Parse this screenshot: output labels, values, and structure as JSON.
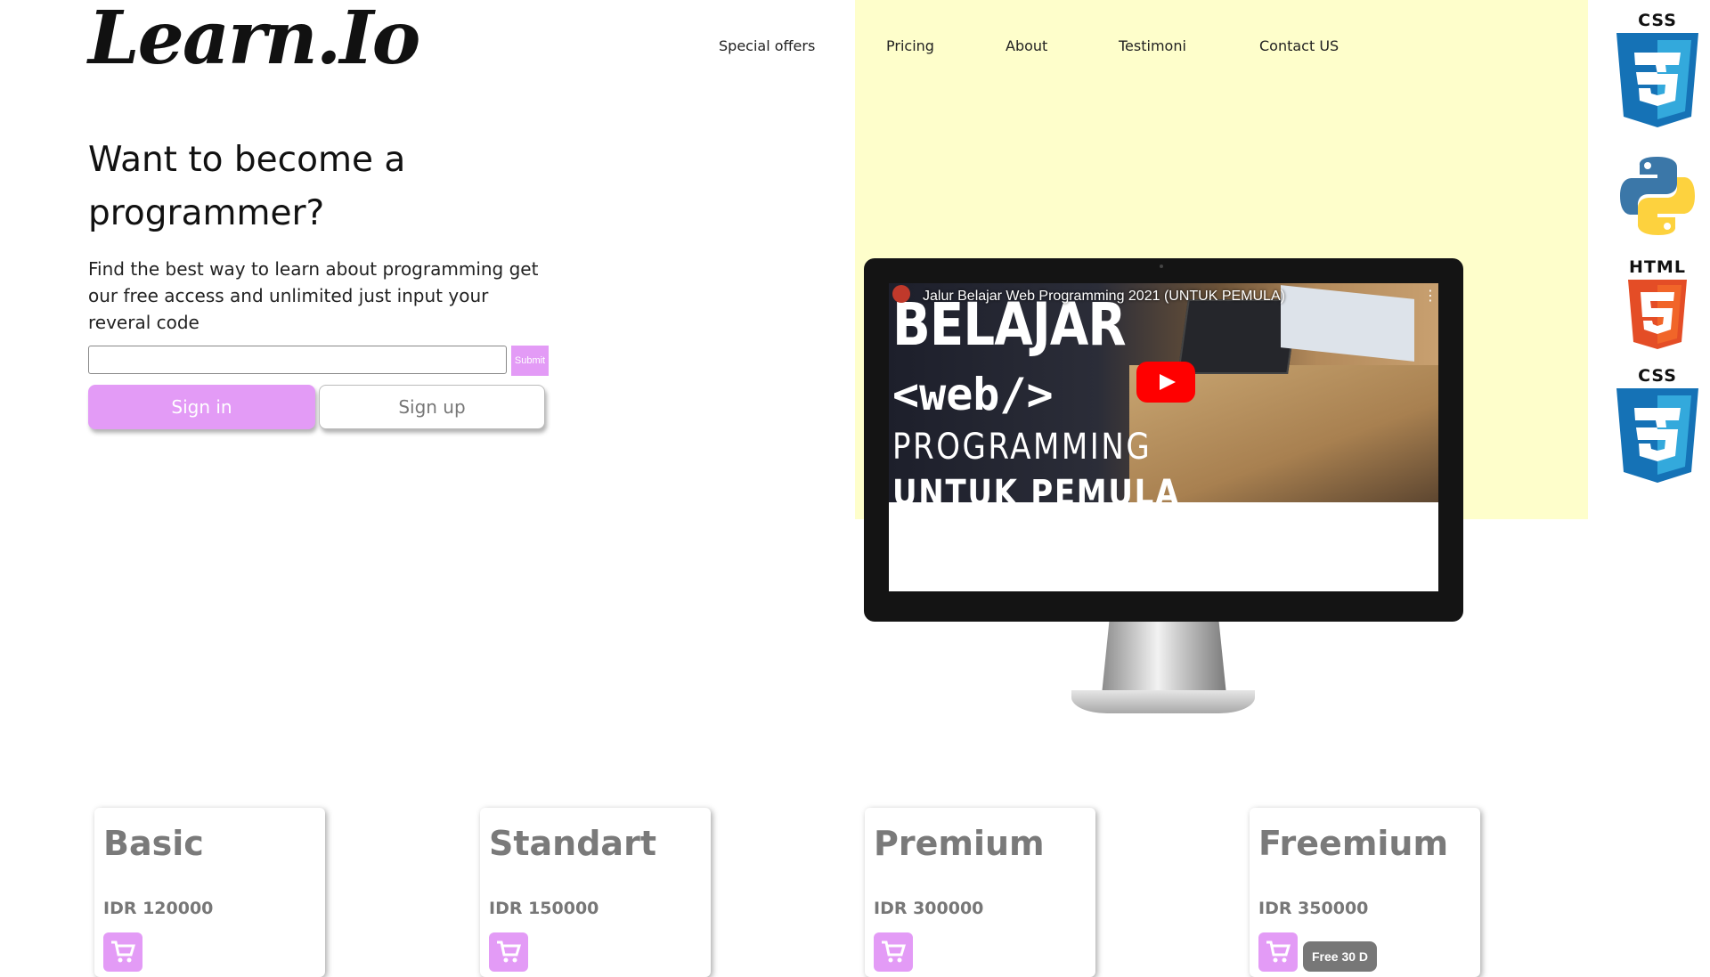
{
  "brand": {
    "logo_text": "Learn.Io"
  },
  "nav": {
    "items": [
      "Special offers",
      "Pricing",
      "About",
      "Testimoni",
      "Contact US"
    ]
  },
  "hero": {
    "title": "Want to become a programmer?",
    "description": "Find the best way to learn about programming get our free access and unlimited just input your reveral code",
    "input_value": "",
    "submit_label": "Submit",
    "signin_label": "Sign in",
    "signup_label": "Sign up"
  },
  "video": {
    "title": "Jalur Belajar Web Programming 2021 (UNTUK PEMULA)",
    "thumb_line1": "BELAJAR",
    "thumb_line2": "<web/>",
    "thumb_line3": "PROGRAMMING",
    "thumb_line4": "UNTUK PEMULA"
  },
  "tech_icons": [
    {
      "label": "CSS",
      "icon": "css3-icon"
    },
    {
      "label": "",
      "icon": "python-icon"
    },
    {
      "label": "HTML",
      "icon": "html5-icon"
    },
    {
      "label": "CSS",
      "icon": "css3-icon"
    }
  ],
  "pricing": {
    "cards": [
      {
        "name": "Basic",
        "price": "IDR 120000",
        "badge": ""
      },
      {
        "name": "Standart",
        "price": "IDR 150000",
        "badge": ""
      },
      {
        "name": "Premium",
        "price": "IDR 300000",
        "badge": ""
      },
      {
        "name": "Freemium",
        "price": "IDR 350000",
        "badge": "Free 30 D"
      }
    ]
  },
  "colors": {
    "accent": "#e39bf6",
    "panel": "#fefecb",
    "badge": "#777777"
  }
}
